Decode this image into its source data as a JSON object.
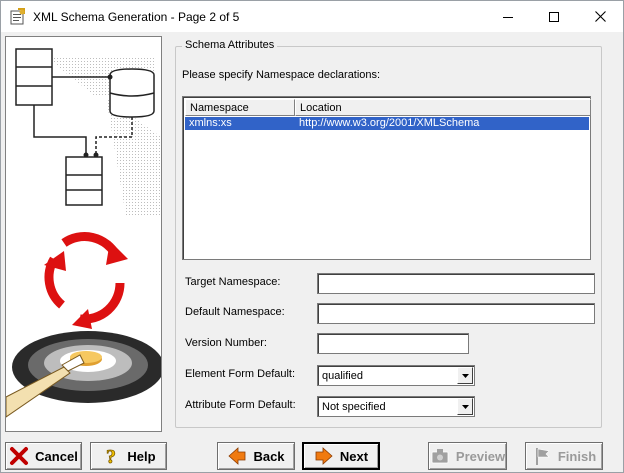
{
  "window": {
    "title": "XML Schema Generation - Page 2 of 5"
  },
  "group": {
    "title": "Schema Attributes",
    "instruction": "Please specify Namespace declarations:"
  },
  "namespaces": {
    "columns": [
      "Namespace",
      "Location"
    ],
    "rows": [
      {
        "namespace": "xmlns:xs",
        "location": "http://www.w3.org/2001/XMLSchema",
        "selected": true
      }
    ]
  },
  "form": {
    "target_namespace_label": "Target Namespace:",
    "target_namespace_value": "",
    "default_namespace_label": "Default Namespace:",
    "default_namespace_value": "",
    "version_number_label": "Version Number:",
    "version_number_value": "",
    "element_form_default_label": "Element Form Default:",
    "element_form_default_value": "qualified",
    "attribute_form_default_label": "Attribute Form Default:",
    "attribute_form_default_value": "Not specified"
  },
  "buttons": {
    "cancel": "Cancel",
    "help": "Help",
    "back": "Back",
    "next": "Next",
    "preview": "Preview",
    "finish": "Finish"
  },
  "colors": {
    "selection": "#3163c8",
    "cancel_icon": "#c00000",
    "help_icon": "#f2c200",
    "nav_arrow": "#f07a10",
    "disabled_text": "#9a9a9a"
  },
  "icons": {
    "app": "xml-schema-app-icon",
    "minimize": "minimize-icon",
    "maximize": "maximize-icon",
    "close": "close-icon",
    "cancel": "red-x-icon",
    "help": "question-mark-icon",
    "back": "left-arrow-icon",
    "next": "right-arrow-icon",
    "preview": "camera-icon",
    "finish": "flag-icon"
  }
}
